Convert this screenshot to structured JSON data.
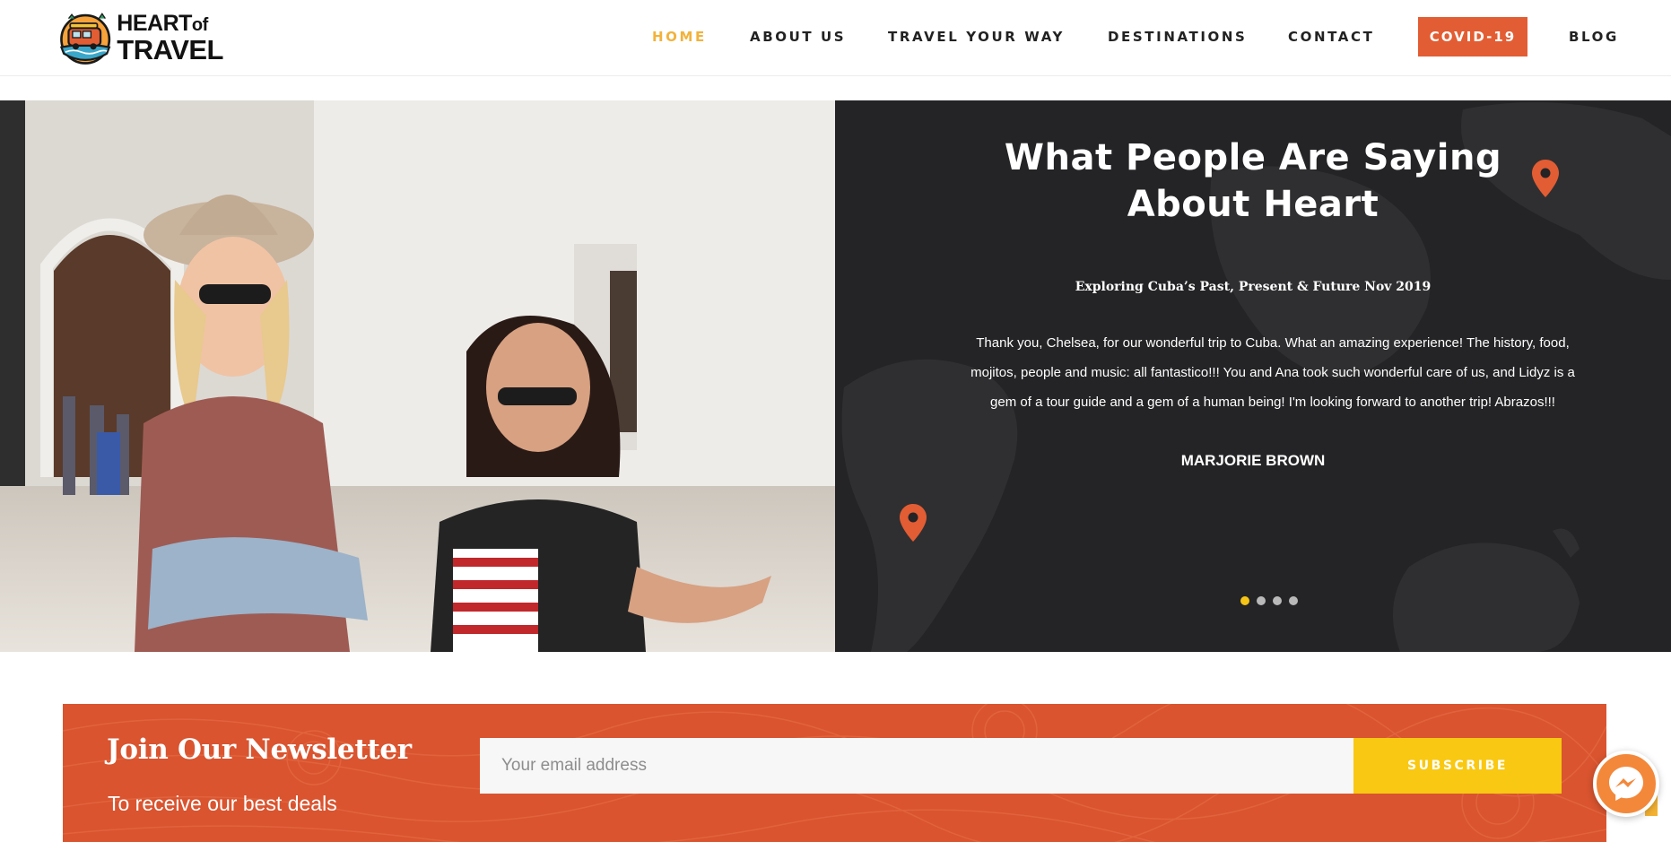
{
  "logo": {
    "line1": "HEART",
    "line1_small": "of",
    "line2": "TRAVEL"
  },
  "nav": {
    "items": [
      {
        "label": "HOME",
        "active": true
      },
      {
        "label": "ABOUT US"
      },
      {
        "label": "TRAVEL YOUR WAY"
      },
      {
        "label": "DESTINATIONS"
      },
      {
        "label": "CONTACT"
      },
      {
        "label": "COVID-19",
        "highlight": true
      },
      {
        "label": "BLOG"
      }
    ]
  },
  "testimonials": {
    "heading": "What People Are Saying About Heart",
    "trip": "Exploring Cuba’s Past, Present & Future Nov 2019",
    "quote": "Thank you, Chelsea, for our wonderful trip to Cuba. What an amazing experience! The history, food, mojitos, people and music: all fantastico!!! You and Ana took such wonderful care of us, and Lidyz is a gem of a tour guide and a gem of a human being! I'm looking forward to another trip! Abrazos!!!",
    "author": "MARJORIE BROWN",
    "slide_count": 4,
    "active_slide": 1
  },
  "newsletter": {
    "title": "Join Our Newsletter",
    "subtitle": "To receive our best deals",
    "email_placeholder": "Your email address",
    "button_label": "SUBSCRIBE"
  },
  "colors": {
    "accent_orange": "#e25d33",
    "active_nav": "#f2b23b",
    "subscribe_yellow": "#f9c812",
    "panel_dark": "#242426"
  }
}
